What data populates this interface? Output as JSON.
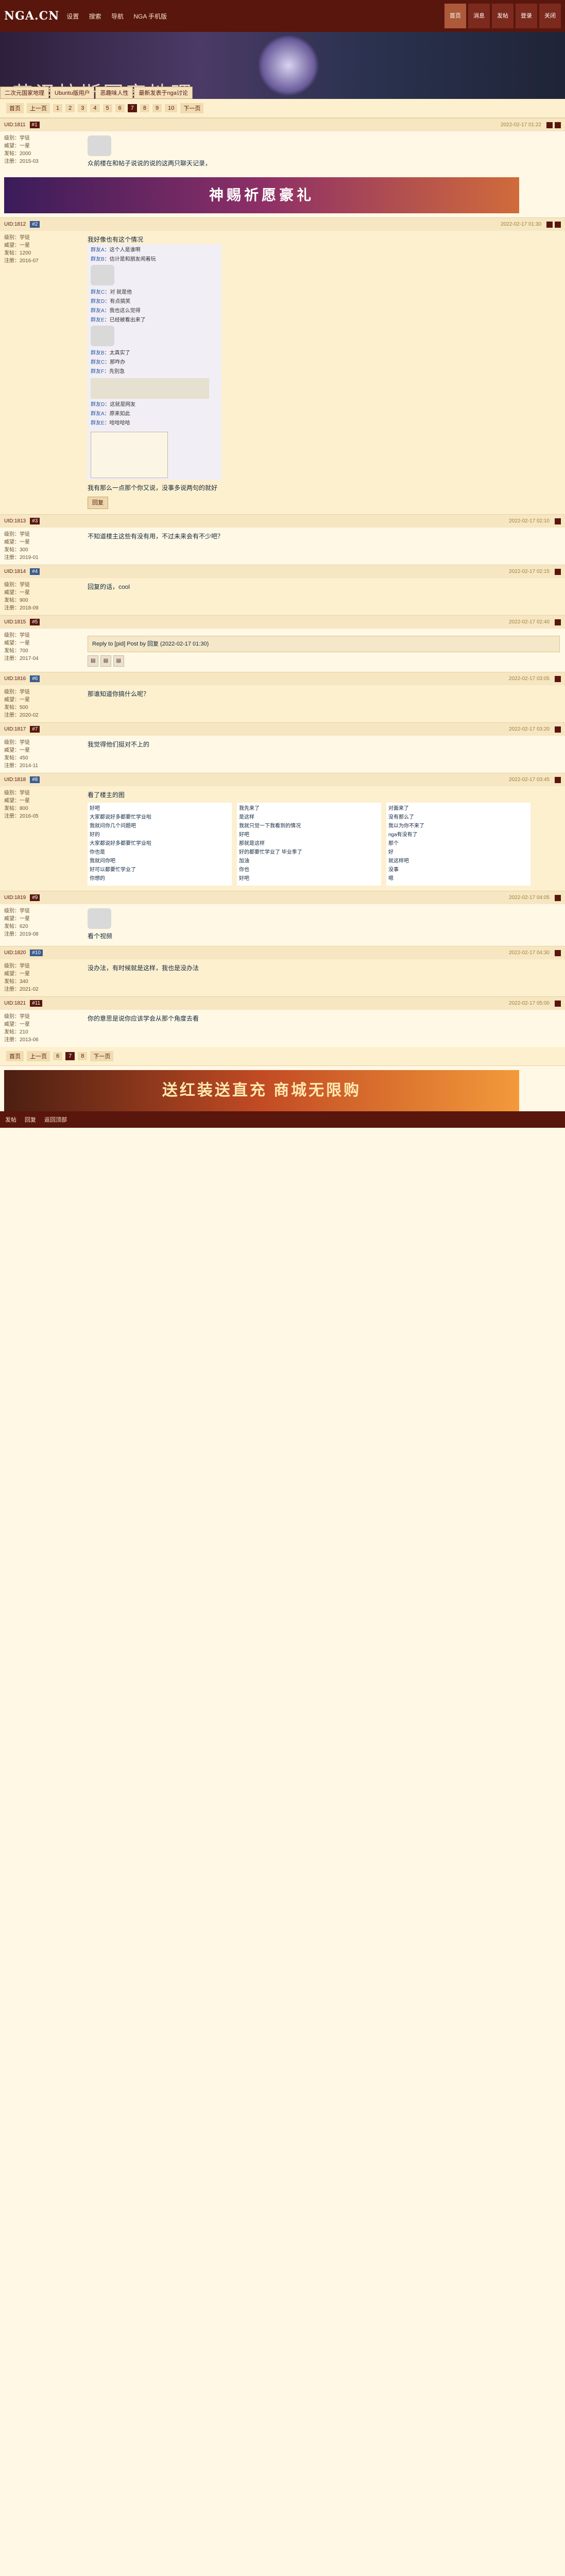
{
  "site": {
    "logo": "NGA.CN"
  },
  "topnav": [
    "设置",
    "搜索",
    "导航",
    "NGA 手机版"
  ],
  "topright": [
    "首页",
    "消息",
    "发帖",
    "登录",
    "关闭"
  ],
  "banner": {
    "title": "艾泽拉斯国家地理"
  },
  "breadcrumb": [
    "二次元国家地理",
    "Ubuntu版用户",
    "恶趣味人性",
    "最新发表于nga讨论"
  ],
  "pager_top": [
    "首页",
    "上一页",
    "1",
    "2",
    "3",
    "4",
    "5",
    "6",
    "7",
    "8",
    "9",
    "10",
    "下一页"
  ],
  "pager_current": "7",
  "ad": {
    "text": "神赐祈愿豪礼"
  },
  "posts": [
    {
      "uid": "UID:1811",
      "tag": "#1",
      "time": "2022-02-17 01:22",
      "text": "众前楼在和帖子说说的说的这两只聊天记录，",
      "side": [
        "级别：学徒",
        "威望：一星",
        "发帖：2000",
        "注册：2015-03"
      ]
    },
    {
      "uid": "UID:1812",
      "tag": "#2",
      "time": "2022-02-17 01:30",
      "text": "我好像也有这个情况",
      "side": [
        "级别：学徒",
        "威望：一星",
        "发帖：1200",
        "注册：2016-07"
      ],
      "chat": [
        {
          "name": "群友A",
          "msg": "这个人是谁啊"
        },
        {
          "name": "群友B",
          "msg": "估计是和朋友闹着玩"
        },
        {
          "name": "群友C",
          "msg": "对 就是他"
        },
        {
          "name": "群友D",
          "msg": "有点搞笑"
        },
        {
          "name": "群友A",
          "msg": "我也这么觉得"
        },
        {
          "name": "群友E",
          "msg": "已经被看出来了"
        },
        {
          "name": "群友B",
          "msg": "太真实了"
        },
        {
          "name": "群友C",
          "msg": "那咋办"
        },
        {
          "name": "群友F",
          "msg": "先别急"
        },
        {
          "name": "群友D",
          "msg": "这就是网友"
        },
        {
          "name": "群友A",
          "msg": "原来如此"
        },
        {
          "name": "群友E",
          "msg": "哈哈哈哈"
        }
      ],
      "footnote": "我有那么一点那个你又说，没事多说两句的就好"
    },
    {
      "uid": "UID:1813",
      "tag": "#3",
      "time": "2022-02-17 02:10",
      "text": "不知道楼主这些有没有用，不过未来会有不少吧？",
      "side": [
        "级别：学徒",
        "威望：一星",
        "发帖：300",
        "注册：2019-01"
      ]
    },
    {
      "uid": "UID:1814",
      "tag": "#4",
      "time": "2022-02-17 02:15",
      "text": "回复的话，cool",
      "side": [
        "级别：学徒",
        "威望：一星",
        "发帖：900",
        "注册：2018-09"
      ]
    },
    {
      "uid": "UID:1815",
      "tag": "#5",
      "time": "2022-02-17 02:40",
      "text": "",
      "side": [
        "级别：学徒",
        "威望：一星",
        "发帖：700",
        "注册：2017-04"
      ],
      "quote": "Reply to [pid] Post by 回复 (2022-02-17 01:30)"
    },
    {
      "uid": "UID:1816",
      "tag": "#6",
      "time": "2022-02-17 03:05",
      "text": "那谁知道你搞什么呢？",
      "side": [
        "级别：学徒",
        "威望：一星",
        "发帖：500",
        "注册：2020-02"
      ]
    },
    {
      "uid": "UID:1817",
      "tag": "#7",
      "time": "2022-02-17 03:20",
      "text": "我觉得他们挺对不上的",
      "side": [
        "级别：学徒",
        "威望：一星",
        "发帖：450",
        "注册：2014-11"
      ]
    },
    {
      "uid": "UID:1818",
      "tag": "#8",
      "time": "2022-02-17 03:45",
      "text": "看了楼主的图",
      "side": [
        "级别：学徒",
        "威望：一星",
        "发帖：800",
        "注册：2016-05"
      ],
      "collage": [
        [
          "好吧",
          "大家都说好多都要忙学业啦",
          "我就问你几个问题吧",
          "好的",
          "大家都说好多都要忙学业啦",
          "你也是",
          "我就问你吧",
          "好可以都要忙学业了",
          "你想的"
        ],
        [
          "我先来了",
          "是这样",
          "我就只觉一下我看到的情况",
          "好吧",
          "那就是这样",
          "好的都要忙学业了 毕业季了",
          "加油",
          "你也",
          "好吧"
        ],
        [
          "对面来了",
          "没有那么了",
          "我以为你不来了",
          "nga有没有了",
          "那个",
          "好",
          "就这样吧",
          "没事",
          "嗯"
        ]
      ]
    },
    {
      "uid": "UID:1819",
      "tag": "#9",
      "time": "2022-02-17 04:05",
      "text": "看个视频",
      "side": [
        "级别：学徒",
        "威望：一星",
        "发帖：620",
        "注册：2019-08"
      ]
    },
    {
      "uid": "UID:1820",
      "tag": "#10",
      "time": "2022-02-17 04:30",
      "text": "没办法，有时候就是这样，我也是没办法",
      "side": [
        "级别：学徒",
        "威望：一星",
        "发帖：340",
        "注册：2021-02"
      ]
    },
    {
      "uid": "UID:1821",
      "tag": "#11",
      "time": "2022-02-17 05:00",
      "text": "你的意思是说你应该学会从那个角度去看",
      "side": [
        "级别：学徒",
        "威望：一星",
        "发帖：210",
        "注册：2013-06"
      ]
    }
  ],
  "reply_button": "回复",
  "pager_bottom": [
    "首页",
    "上一页",
    "6",
    "7",
    "8",
    "下一页"
  ],
  "bottom_ad": {
    "text": "送红装送直充 商城无限购"
  },
  "footer": [
    "发帖",
    "回复",
    "返回顶部"
  ]
}
